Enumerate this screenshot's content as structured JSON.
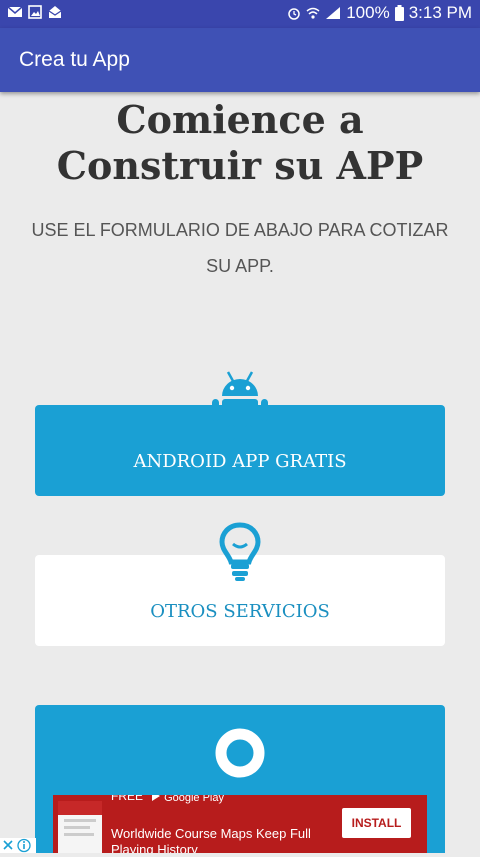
{
  "status_bar": {
    "battery": "100%",
    "time": "3:13 PM",
    "icons": [
      "mail-icon",
      "image-icon",
      "email-open-icon",
      "alarm-icon",
      "wifi-icon",
      "signal-icon",
      "battery-icon"
    ]
  },
  "app_bar": {
    "title": "Crea tu App",
    "color": "#3f51b5"
  },
  "headline": {
    "line1": "Comience a",
    "line2": "Construir su APP"
  },
  "subtitle": "USE EL FORMULARIO DE ABAJO PARA COTIZAR SU APP.",
  "cards": [
    {
      "label": "ANDROID APP GRATIS",
      "icon": "android-icon",
      "color": "#1aa0d4"
    },
    {
      "label": "OTROS SERVICIOS",
      "icon": "lightbulb-icon",
      "color": "#ffffff"
    },
    {
      "label": "",
      "icon": "ring-icon",
      "color": "#1aa0d4"
    }
  ],
  "ad": {
    "free_label": "FREE",
    "store_label": "Google Play",
    "text": "Worldwide Course Maps Keep Full Playing History",
    "install_label": "INSTALL",
    "color": "#b71c1c"
  }
}
